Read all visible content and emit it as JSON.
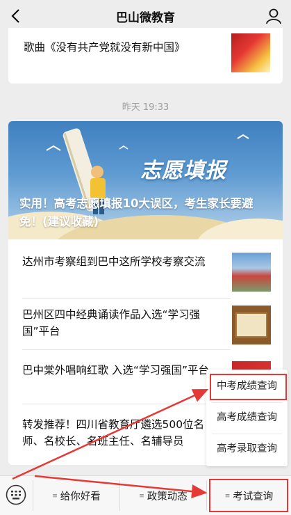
{
  "header": {
    "title": "巴山微教育"
  },
  "top_card": {
    "title": "歌曲《没有共产党就没有新中国》"
  },
  "timestamp": "昨天 19:33",
  "hero": {
    "title": "实用！高考志愿填报10大误区，考生家长要避免！(建议收藏)",
    "image_text": "志愿填报"
  },
  "articles": [
    {
      "title": "达州市考察组到巴中这所学校考察交流"
    },
    {
      "title": "巴州区四中经典诵读作品入选“学习强国”平台"
    },
    {
      "title": "巴中棠外唱响红歌  入选“学习强国”平台"
    },
    {
      "title": "转发推荐！四川省教育厅遴选500位名师、名校长、名班主任、名辅导员"
    }
  ],
  "popup_menu": {
    "items": [
      "中考成绩查询",
      "高考成绩查询",
      "高考录取查询"
    ]
  },
  "bottom_menu": {
    "items": [
      "给你好看",
      "政策动态",
      "考试查询"
    ]
  },
  "colors": {
    "highlight": "#e53935",
    "background": "#ededed"
  }
}
